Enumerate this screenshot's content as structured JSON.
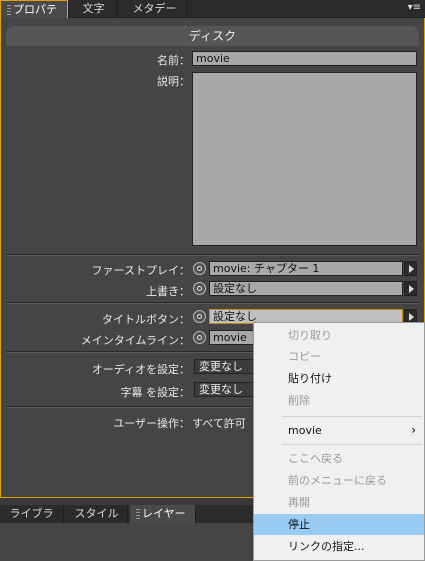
{
  "top_tabs": [
    {
      "label": "プロパティ",
      "active": true
    },
    {
      "label": "文字",
      "active": false
    },
    {
      "label": "メタデータ",
      "active": false
    }
  ],
  "panel": {
    "header": "ディスク",
    "name_label": "名前：",
    "name_value": "movie",
    "desc_label": "説明：",
    "first_play_label": "ファーストプレイ：",
    "first_play_value": "movie: チャプター 1",
    "override_label": "上書き：",
    "override_value": "設定なし",
    "title_button_label": "タイトルボタン：",
    "title_button_value": "設定なし",
    "main_timeline_label": "メインタイムライン：",
    "main_timeline_value": "movie",
    "audio_label": "オーディオを設定：",
    "audio_value": "変更なし",
    "subtitle_label": "字幕 を設定：",
    "subtitle_value": "変更なし",
    "user_ops_label": "ユーザー操作：",
    "user_ops_value": "すべて許可"
  },
  "bottom_tabs": [
    {
      "label": "ライブラリ",
      "active": false
    },
    {
      "label": "スタイル",
      "active": false
    },
    {
      "label": "レイヤー",
      "active": true
    }
  ],
  "context_menu": {
    "items": [
      {
        "label": "切り取り",
        "enabled": false
      },
      {
        "label": "コピー",
        "enabled": false
      },
      {
        "label": "貼り付け",
        "enabled": true
      },
      {
        "label": "削除",
        "enabled": false
      },
      {
        "label": "movie",
        "enabled": true,
        "submenu": true
      },
      {
        "label": "ここへ戻る",
        "enabled": false
      },
      {
        "label": "前のメニューに戻る",
        "enabled": false
      },
      {
        "label": "再開",
        "enabled": false
      },
      {
        "label": "停止",
        "enabled": true,
        "highlighted": true
      },
      {
        "label": "リンクの指定...",
        "enabled": true
      }
    ]
  },
  "colors": {
    "accent": "#e0a000",
    "highlight": "#99ccf5",
    "panel_bg": "#454545"
  }
}
